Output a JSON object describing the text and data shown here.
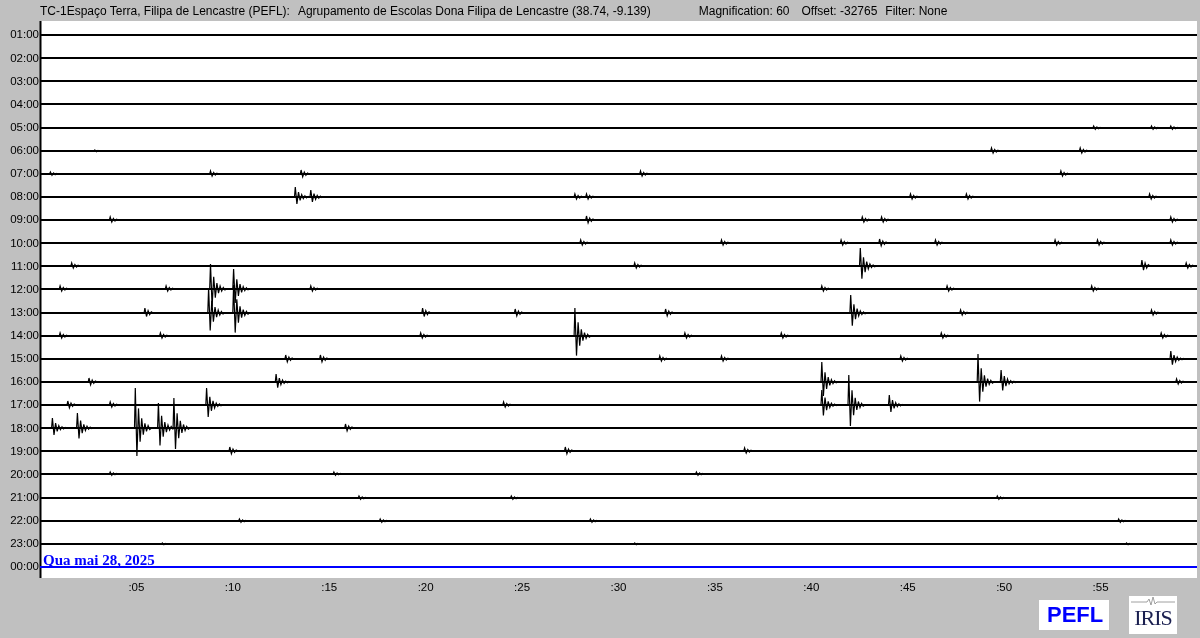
{
  "header": {
    "station": "TC-1Espaço Terra, Filipa de Lencastre (PEFL):",
    "site": "Agrupamento de Escolas Dona Filipa de Lencastre (38.74, -9.139)",
    "magnification": "Magnification: 60",
    "offset": "Offset: -32765",
    "filter": "Filter: None"
  },
  "traces": [
    {
      "label": "01:00",
      "color": "#000000"
    },
    {
      "label": "02:00",
      "color": "#000000"
    },
    {
      "label": "03:00",
      "color": "#000000"
    },
    {
      "label": "04:00",
      "color": "#000000"
    },
    {
      "label": "05:00",
      "color": "#000000"
    },
    {
      "label": "06:00",
      "color": "#000000"
    },
    {
      "label": "07:00",
      "color": "#000000"
    },
    {
      "label": "08:00",
      "color": "#000000"
    },
    {
      "label": "09:00",
      "color": "#000000"
    },
    {
      "label": "10:00",
      "color": "#000000"
    },
    {
      "label": "11:00",
      "color": "#000000"
    },
    {
      "label": "12:00",
      "color": "#000000"
    },
    {
      "label": "13:00",
      "color": "#000000"
    },
    {
      "label": "14:00",
      "color": "#000000"
    },
    {
      "label": "15:00",
      "color": "#000000"
    },
    {
      "label": "16:00",
      "color": "#000000"
    },
    {
      "label": "17:00",
      "color": "#000000"
    },
    {
      "label": "18:00",
      "color": "#000000"
    },
    {
      "label": "19:00",
      "color": "#000000"
    },
    {
      "label": "20:00",
      "color": "#000000"
    },
    {
      "label": "21:00",
      "color": "#000000"
    },
    {
      "label": "22:00",
      "color": "#000000"
    },
    {
      "label": "23:00",
      "color": "#000000"
    },
    {
      "label": "00:00",
      "color": "#0000ff"
    }
  ],
  "date_label": "Qua mai 28, 2025",
  "minute_labels": [
    ":05",
    ":10",
    ":15",
    ":20",
    ":25",
    ":30",
    ":35",
    ":40",
    ":45",
    ":50",
    ":55"
  ],
  "logos": {
    "station": "PEFL",
    "network": "IRIS"
  }
}
